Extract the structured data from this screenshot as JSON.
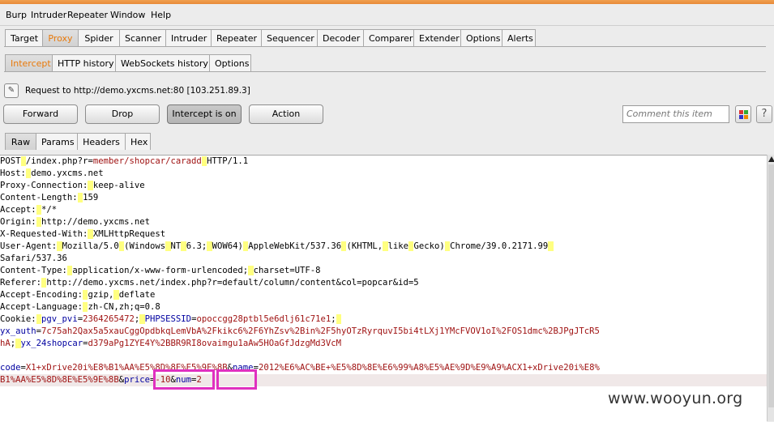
{
  "menu": [
    "Burp",
    "Intruder",
    "Repeater",
    "Window",
    "Help"
  ],
  "main_tabs": [
    "Target",
    "Proxy",
    "Spider",
    "Scanner",
    "Intruder",
    "Repeater",
    "Sequencer",
    "Decoder",
    "Comparer",
    "Extender",
    "Options",
    "Alerts"
  ],
  "proxy_tabs": [
    "Intercept",
    "HTTP history",
    "WebSockets history",
    "Options"
  ],
  "request_label": "Request to http://demo.yxcms.net:80  [103.251.89.3]",
  "buttons": {
    "forward": "Forward",
    "drop": "Drop",
    "intercept": "Intercept is on",
    "action": "Action"
  },
  "comment_placeholder": "Comment this item",
  "help_label": "?",
  "view_tabs": [
    "Raw",
    "Params",
    "Headers",
    "Hex"
  ],
  "request_lines": [
    [
      [
        "k",
        "POST"
      ],
      [
        "hl",
        " "
      ],
      [
        "k",
        "/index.php?r="
      ],
      [
        "v",
        "member/shopcar/caradd"
      ],
      [
        "hl",
        " "
      ],
      [
        "k",
        "HTTP/1.1"
      ]
    ],
    [
      [
        "k",
        "Host:"
      ],
      [
        "hl",
        " "
      ],
      [
        "k",
        "demo.yxcms.net"
      ]
    ],
    [
      [
        "k",
        "Proxy-Connection:"
      ],
      [
        "hl",
        " "
      ],
      [
        "k",
        "keep-alive"
      ]
    ],
    [
      [
        "k",
        "Content-Length:"
      ],
      [
        "hl",
        " "
      ],
      [
        "k",
        "159"
      ]
    ],
    [
      [
        "k",
        "Accept:"
      ],
      [
        "hl",
        " "
      ],
      [
        "k",
        "*/*"
      ]
    ],
    [
      [
        "k",
        "Origin:"
      ],
      [
        "hl",
        " "
      ],
      [
        "k",
        "http://demo.yxcms.net"
      ]
    ],
    [
      [
        "k",
        "X-Requested-With:"
      ],
      [
        "hl",
        " "
      ],
      [
        "k",
        "XMLHttpRequest"
      ]
    ],
    [
      [
        "k",
        "User-Agent:"
      ],
      [
        "hl",
        " "
      ],
      [
        "k",
        "Mozilla/5.0"
      ],
      [
        "hl",
        " "
      ],
      [
        "k",
        "(Windows"
      ],
      [
        "hl",
        " "
      ],
      [
        "k",
        "NT"
      ],
      [
        "hl",
        " "
      ],
      [
        "k",
        "6.3;"
      ],
      [
        "hl",
        " "
      ],
      [
        "k",
        "WOW64)"
      ],
      [
        "hl",
        " "
      ],
      [
        "k",
        "AppleWebKit/537.36"
      ],
      [
        "hl",
        " "
      ],
      [
        "k",
        "(KHTML,"
      ],
      [
        "hl",
        " "
      ],
      [
        "k",
        "like"
      ],
      [
        "hl",
        " "
      ],
      [
        "k",
        "Gecko)"
      ],
      [
        "hl",
        " "
      ],
      [
        "k",
        "Chrome/39.0.2171.99"
      ],
      [
        "hl",
        " "
      ]
    ],
    [
      [
        "k",
        "Safari/537.36"
      ]
    ],
    [
      [
        "k",
        "Content-Type:"
      ],
      [
        "hl",
        " "
      ],
      [
        "k",
        "application/x-www-form-urlencoded;"
      ],
      [
        "hl",
        " "
      ],
      [
        "k",
        "charset=UTF-8"
      ]
    ],
    [
      [
        "k",
        "Referer:"
      ],
      [
        "hl",
        " "
      ],
      [
        "k",
        "http://demo.yxcms.net/index.php?r=default/column/content&col=popcar&id=5"
      ]
    ],
    [
      [
        "k",
        "Accept-Encoding:"
      ],
      [
        "hl",
        " "
      ],
      [
        "k",
        "gzip,"
      ],
      [
        "hl",
        " "
      ],
      [
        "k",
        "deflate"
      ]
    ],
    [
      [
        "k",
        "Accept-Language:"
      ],
      [
        "hl",
        " "
      ],
      [
        "k",
        "zh-CN,zh;q=0.8"
      ]
    ],
    [
      [
        "k",
        "Cookie:"
      ],
      [
        "hl",
        " "
      ],
      [
        "ck",
        "pgv_pvi"
      ],
      [
        "k",
        "="
      ],
      [
        "v",
        "2364265472"
      ],
      [
        "k",
        ";"
      ],
      [
        "hl",
        " "
      ],
      [
        "ck",
        "PHPSESSID"
      ],
      [
        "k",
        "="
      ],
      [
        "v",
        "opoccgg28ptbl5e6dlj61c71e1"
      ],
      [
        "k",
        ";"
      ],
      [
        "hl",
        " "
      ]
    ],
    [
      [
        "ck",
        "yx_auth"
      ],
      [
        "k",
        "="
      ],
      [
        "v",
        "7c75ah2Qax5a5xauCggOpdbkqLemVbA%2Fkikc6%2F6YhZsv%2Bin%2F5hyOTzRyrquvI5bi4tLXj1YMcFVOV1oI%2FOS1dmc%2BJPgJTcR5"
      ]
    ],
    [
      [
        "v",
        "hA"
      ],
      [
        "k",
        ";"
      ],
      [
        "hl",
        " "
      ],
      [
        "ck",
        "yx_24shopcar"
      ],
      [
        "k",
        "="
      ],
      [
        "v",
        "d379aPg1ZYE4Y%2BBR9RI8ovaimgu1aAw5HOaGfJdzgMd3VcM"
      ]
    ],
    [],
    [
      [
        "ck",
        "code"
      ],
      [
        "k",
        "="
      ],
      [
        "v",
        "X1+xDrive20i%E8%B1%AA%E5%8D%8E%E5%9E%8B"
      ],
      [
        "k",
        "&"
      ],
      [
        "ck",
        "name"
      ],
      [
        "k",
        "="
      ],
      [
        "v",
        "2012%E6%AC%BE+%E5%8D%8E%E6%99%A8%E5%AE%9D%E9%A9%ACX1+xDrive20i%E8%"
      ]
    ],
    [
      [
        "v",
        "B1%AA%E5%8D%8E%E5%9E%8B"
      ],
      [
        "k",
        "&"
      ],
      [
        "ck",
        "price"
      ],
      [
        "k",
        "="
      ],
      [
        "v",
        "-10"
      ],
      [
        "k",
        "&"
      ],
      [
        "ck",
        "num"
      ],
      [
        "k",
        "="
      ],
      [
        "v",
        "2"
      ]
    ]
  ],
  "watermark": "www.wooyun.org"
}
